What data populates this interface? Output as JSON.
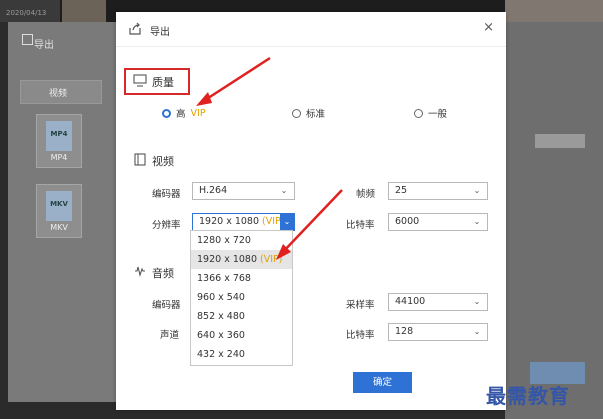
{
  "background": {
    "date_text": "2020/04/13",
    "dialog_title": "导出",
    "tab_label": "视频",
    "formats": [
      {
        "badge": "MP4",
        "label": "MP4"
      },
      {
        "badge": "MKV",
        "label": "MKV"
      }
    ]
  },
  "dialog": {
    "title": "导出",
    "close_glyph": "×",
    "quality": {
      "heading": "质量",
      "options": [
        {
          "label": "高",
          "vip": "VIP",
          "selected": true
        },
        {
          "label": "标准",
          "selected": false
        },
        {
          "label": "一般",
          "selected": false
        }
      ]
    },
    "video": {
      "heading": "视频",
      "encoder_label": "编码器",
      "encoder_value": "H.264",
      "framerate_label": "帧频",
      "framerate_value": "25",
      "resolution_label": "分辨率",
      "resolution_value": "1920 x 1080",
      "resolution_vip": "(VIP)",
      "bitrate_label": "比特率",
      "bitrate_value": "6000"
    },
    "resolution_options": [
      {
        "text": "1280 x 720",
        "vip": ""
      },
      {
        "text": "1920 x 1080",
        "vip": "(VIP)"
      },
      {
        "text": "1366 x 768",
        "vip": ""
      },
      {
        "text": "960 x 540",
        "vip": ""
      },
      {
        "text": "852 x 480",
        "vip": ""
      },
      {
        "text": "640 x 360",
        "vip": ""
      },
      {
        "text": "432 x 240",
        "vip": ""
      }
    ],
    "audio": {
      "heading": "音频",
      "encoder_label": "编码器",
      "samplerate_label": "采样率",
      "samplerate_value": "44100",
      "channel_label": "声道",
      "bitrate_label": "比特率",
      "bitrate_value": "128"
    },
    "ok_label": "确定"
  },
  "watermark": "最需教育",
  "colors": {
    "accent": "#2f72d6",
    "vip": "#e1a000",
    "highlight_box": "#d62a2a"
  },
  "icons": [
    "export-icon",
    "close-icon",
    "monitor-icon",
    "video-icon",
    "audio-icon",
    "chevron-down-icon"
  ]
}
